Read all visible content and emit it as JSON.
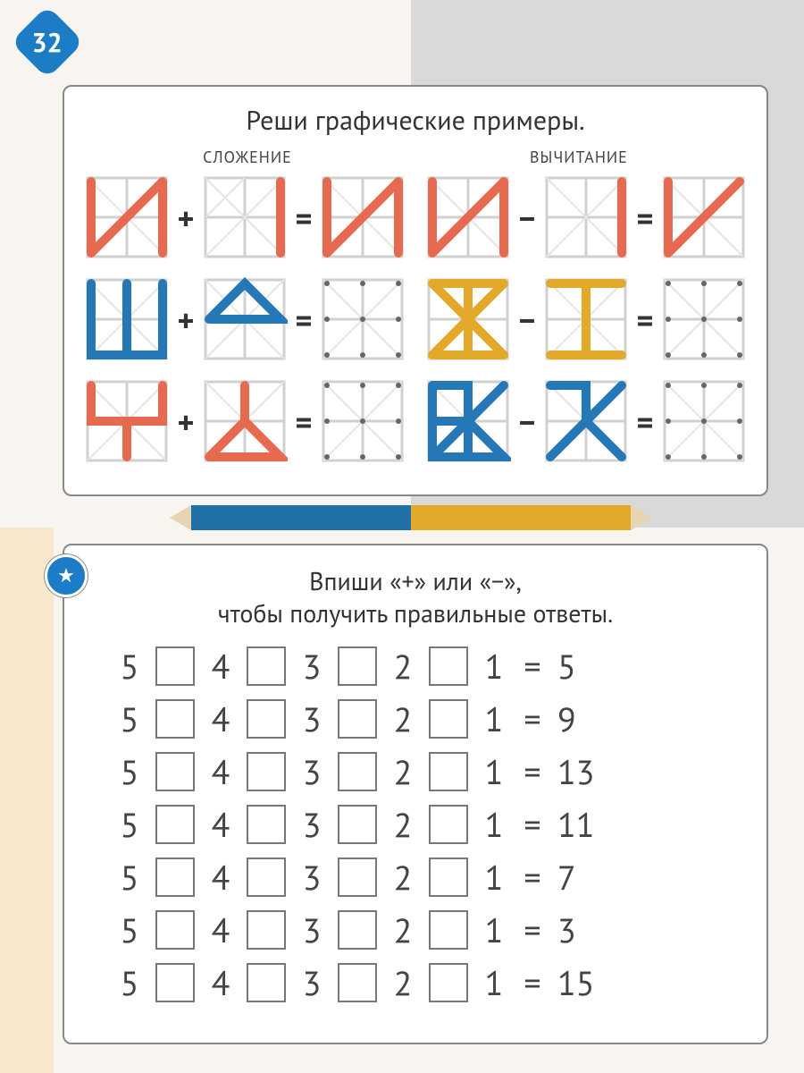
{
  "page_number": "32",
  "card1": {
    "title": "Реши графические примеры.",
    "addition_header": "СЛОЖЕНИЕ",
    "subtraction_header": "ВЫЧИТАНИЕ",
    "plus": "+",
    "minus": "−",
    "equals": "="
  },
  "star": "★",
  "card2": {
    "title_line1": "Впиши «+» или «−»,",
    "title_line2": "чтобы получить правильные ответы.",
    "operands": [
      "5",
      "4",
      "3",
      "2",
      "1"
    ],
    "equals": "=",
    "answers": [
      "5",
      "9",
      "13",
      "11",
      "7",
      "3",
      "15"
    ]
  }
}
